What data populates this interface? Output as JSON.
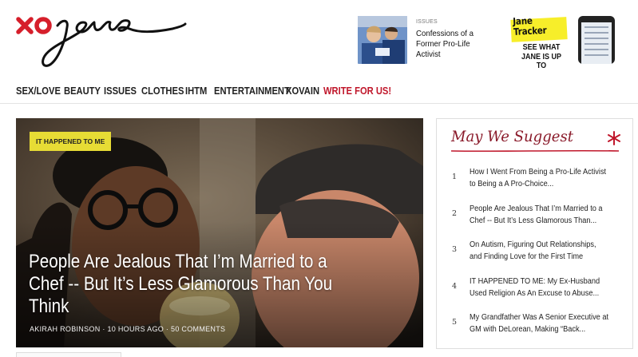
{
  "brand": {
    "logo_text": "xojane",
    "accent": "#d61f2b"
  },
  "promo": {
    "kicker": "ISSUES",
    "title": "Confessions of a Former Pro-Life Activist"
  },
  "tracker": {
    "name_line1": "Jane",
    "name_line2": "Tracker",
    "cta_line1": "SEE WHAT",
    "cta_line2": "JANE IS UP TO",
    "badge_color": "#f7ee2a"
  },
  "nav": {
    "items": [
      "SEX/LOVE",
      "BEAUTY",
      "ISSUES",
      "CLOTHES",
      "IHTM",
      "ENTERTAINMENT",
      "XOVAIN"
    ],
    "write_label": "WRITE FOR US!",
    "write_color": "#c0172b"
  },
  "hero": {
    "tag": "IT HAPPENED TO ME",
    "title": "People Are Jealous That I’m Married to a Chef -- But It’s Less Glamorous Than You Think",
    "author": "AKIRAH ROBINSON",
    "time": "10 HOURS AGO",
    "comments": "50 COMMENTS",
    "separator": "·",
    "tag_color": "#e7dc35"
  },
  "suggest": {
    "title": "May We Suggest",
    "title_color": "#8a1a2a",
    "items": [
      {
        "num": "1",
        "text": "How I Went From Being a Pro-Life Activist to Being a A Pro-Choice..."
      },
      {
        "num": "2",
        "text": "People Are Jealous That I’m Married to a Chef -- But It’s Less Glamorous Than..."
      },
      {
        "num": "3",
        "text": "On Autism, Figuring Out Relationships, and Finding Love for the First Time"
      },
      {
        "num": "4",
        "text": "IT HAPPENED TO ME: My Ex-Husband Used Religion As An Excuse to Abuse..."
      },
      {
        "num": "5",
        "text": "My Grandfather Was A Senior Executive at GM with DeLorean, Making “Back..."
      }
    ]
  }
}
